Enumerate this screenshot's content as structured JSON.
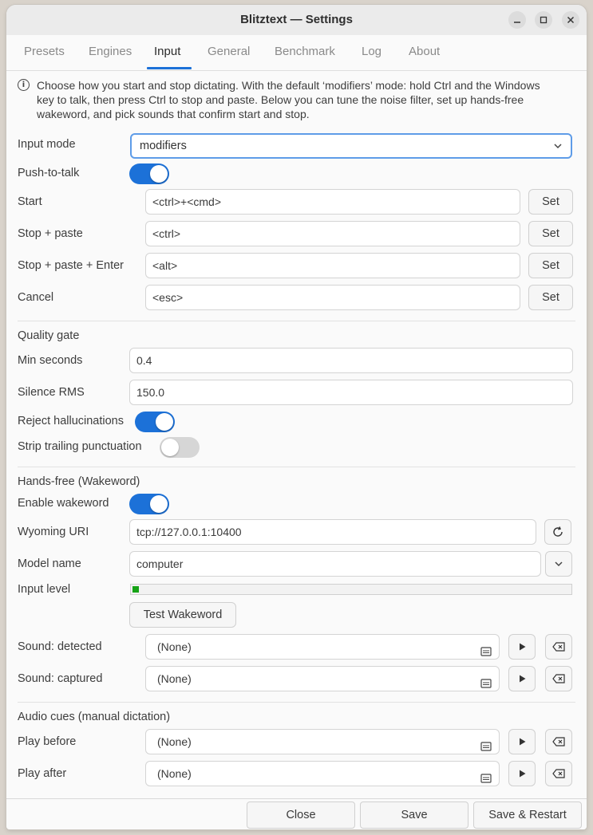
{
  "window": {
    "title": "Blitztext — Settings"
  },
  "tabs": [
    "Presets",
    "Engines",
    "Input",
    "General",
    "Benchmark",
    "Log",
    "About"
  ],
  "active_tab": "Input",
  "info_text": "Choose how you start and stop dictating. With the default ‘modifiers’ mode: hold Ctrl and the Windows key to talk, then press Ctrl to stop and paste. Below you can tune the noise filter, set up hands-free wakeword, and pick sounds that confirm start and stop.",
  "input_mode": {
    "label": "Input mode",
    "value": "modifiers"
  },
  "push_to_talk": {
    "label": "Push-to-talk",
    "on": true
  },
  "hotkeys": [
    {
      "label": "Start",
      "value": "<ctrl>+<cmd>",
      "button": "Set"
    },
    {
      "label": "Stop + paste",
      "value": "<ctrl>",
      "button": "Set"
    },
    {
      "label": "Stop + paste + Enter",
      "value": "<alt>",
      "button": "Set"
    },
    {
      "label": "Cancel",
      "value": "<esc>",
      "button": "Set"
    }
  ],
  "quality_gate": {
    "title": "Quality gate",
    "min_seconds": {
      "label": "Min seconds",
      "value": "0.4"
    },
    "silence_rms": {
      "label": "Silence RMS",
      "value": "150.0"
    },
    "reject_hallucinations": {
      "label": "Reject hallucinations",
      "on": true
    },
    "strip_trailing_punctuation": {
      "label": "Strip trailing punctuation",
      "on": false
    }
  },
  "wakeword": {
    "title": "Hands-free (Wakeword)",
    "enable": {
      "label": "Enable wakeword",
      "on": true
    },
    "wyoming_uri": {
      "label": "Wyoming URI",
      "value": "tcp://127.0.0.1:10400"
    },
    "model_name": {
      "label": "Model name",
      "value": "computer"
    },
    "input_level": {
      "label": "Input level",
      "fraction": 0.015
    },
    "test_button": "Test Wakeword",
    "sound_detected": {
      "label": "Sound: detected",
      "value": "(None)"
    },
    "sound_captured": {
      "label": "Sound: captured",
      "value": "(None)"
    }
  },
  "audio_cues": {
    "title": "Audio cues (manual dictation)",
    "play_before": {
      "label": "Play before",
      "value": "(None)"
    },
    "play_after": {
      "label": "Play after",
      "value": "(None)"
    }
  },
  "footer": {
    "close": "Close",
    "save": "Save",
    "save_restart": "Save & Restart"
  },
  "colors": {
    "accent": "#1c71d8",
    "level": "#16a316",
    "switch_off": "#d6d6d6"
  }
}
